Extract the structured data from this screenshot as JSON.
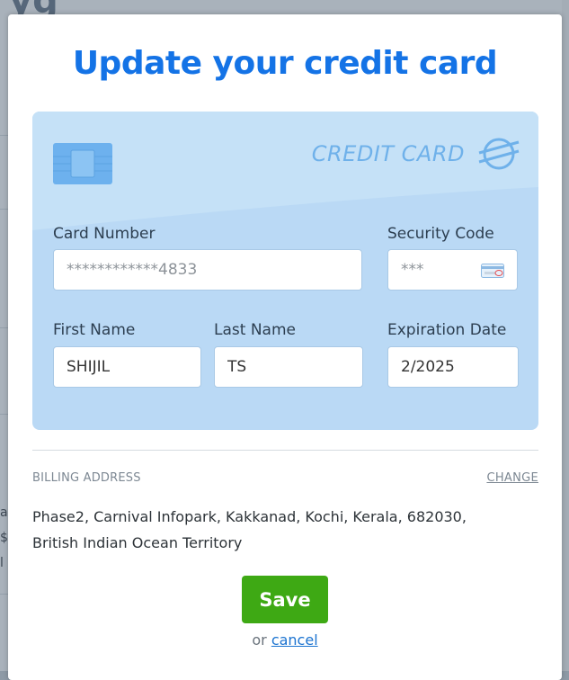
{
  "background": {
    "heading_fragment": "yg",
    "side_fragments": [
      "a",
      "$",
      "l"
    ]
  },
  "modal": {
    "title": "Update your credit card",
    "card": {
      "brand": "CREDIT CARD",
      "card_number": {
        "label": "Card Number",
        "value": "************4833"
      },
      "security_code": {
        "label": "Security Code",
        "placeholder": "***"
      },
      "first_name": {
        "label": "First Name",
        "value": "SHIJIL"
      },
      "last_name": {
        "label": "Last Name",
        "value": "TS"
      },
      "expiration": {
        "label": "Expiration Date",
        "value": "2/2025"
      }
    },
    "billing": {
      "label": "BILLING ADDRESS",
      "change_label": "CHANGE",
      "address_line1": "Phase2, Carnival Infopark, Kakkanad, Kochi, Kerala, 682030,",
      "address_line2": "British Indian Ocean Territory"
    },
    "save_label": "Save",
    "cancel_prefix": "or",
    "cancel_label": "cancel"
  },
  "colors": {
    "title": "#1473e6",
    "card_bg": "#bad9f5",
    "save_bg": "#3ea914",
    "link": "#1b73d0"
  }
}
